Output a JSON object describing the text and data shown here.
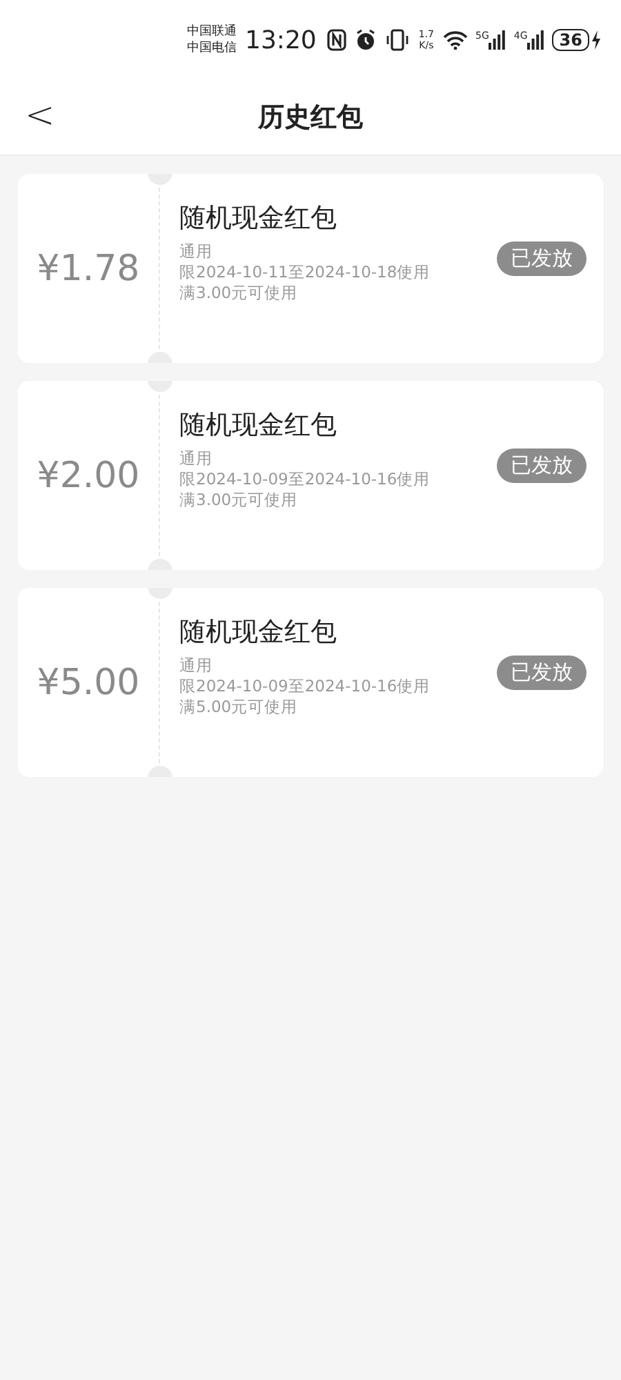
{
  "status_bar": {
    "carriers": [
      "中国联通",
      "中国电信"
    ],
    "time": "13:20",
    "speed": [
      "1.7",
      "K/s"
    ],
    "networks": [
      "5G",
      "4G"
    ],
    "battery": "36"
  },
  "header": {
    "back": "<",
    "title": "历史红包"
  },
  "coupons": [
    {
      "amount": "¥1.78",
      "title": "随机现金红包",
      "scope": "通用",
      "validity": "限2024-10-11至2024-10-18使用",
      "condition": "满3.00元可使用",
      "status": "已发放"
    },
    {
      "amount": "¥2.00",
      "title": "随机现金红包",
      "scope": "通用",
      "validity": "限2024-10-09至2024-10-16使用",
      "condition": "满3.00元可使用",
      "status": "已发放"
    },
    {
      "amount": "¥5.00",
      "title": "随机现金红包",
      "scope": "通用",
      "validity": "限2024-10-09至2024-10-16使用",
      "condition": "满5.00元可使用",
      "status": "已发放"
    }
  ]
}
